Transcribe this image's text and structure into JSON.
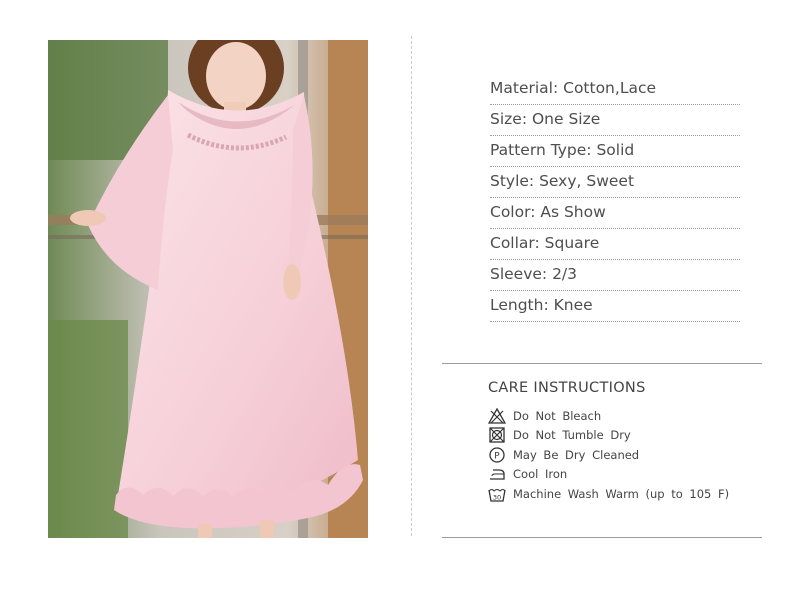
{
  "product_photo": {
    "alt": "Model wearing pink nightgown"
  },
  "specs": [
    {
      "label": "Material",
      "value": "Cotton,Lace",
      "text": "Material: Cotton,Lace"
    },
    {
      "label": "Size",
      "value": "One Size",
      "text": "Size: One Size"
    },
    {
      "label": "Pattern Type",
      "value": "Solid",
      "text": "Pattern Type: Solid"
    },
    {
      "label": "Style",
      "value": "Sexy, Sweet",
      "text": "Style: Sexy, Sweet"
    },
    {
      "label": "Color",
      "value": "As Show",
      "text": "Color: As Show"
    },
    {
      "label": "Collar",
      "value": "Square",
      "text": "Collar: Square"
    },
    {
      "label": "Sleeve",
      "value": "2/3",
      "text": "Sleeve: 2/3"
    },
    {
      "label": "Length",
      "value": "Knee",
      "text": "Length: Knee"
    }
  ],
  "care": {
    "title": "CARE  INSTRUCTIONS",
    "items": [
      {
        "icon": "do-not-bleach-icon",
        "text": "Do Not Bleach"
      },
      {
        "icon": "do-not-tumble-dry-icon",
        "text": "Do Not Tumble Dry"
      },
      {
        "icon": "dry-clean-icon",
        "text": "May Be Dry Cleaned"
      },
      {
        "icon": "cool-iron-icon",
        "text": "Cool Iron"
      },
      {
        "icon": "machine-wash-icon",
        "icon_text": "30",
        "text": "Machine Wash Warm (up to 105 F)"
      }
    ]
  },
  "colors": {
    "dress_pink": "#f7d4dc",
    "text": "#4e4e4e"
  }
}
